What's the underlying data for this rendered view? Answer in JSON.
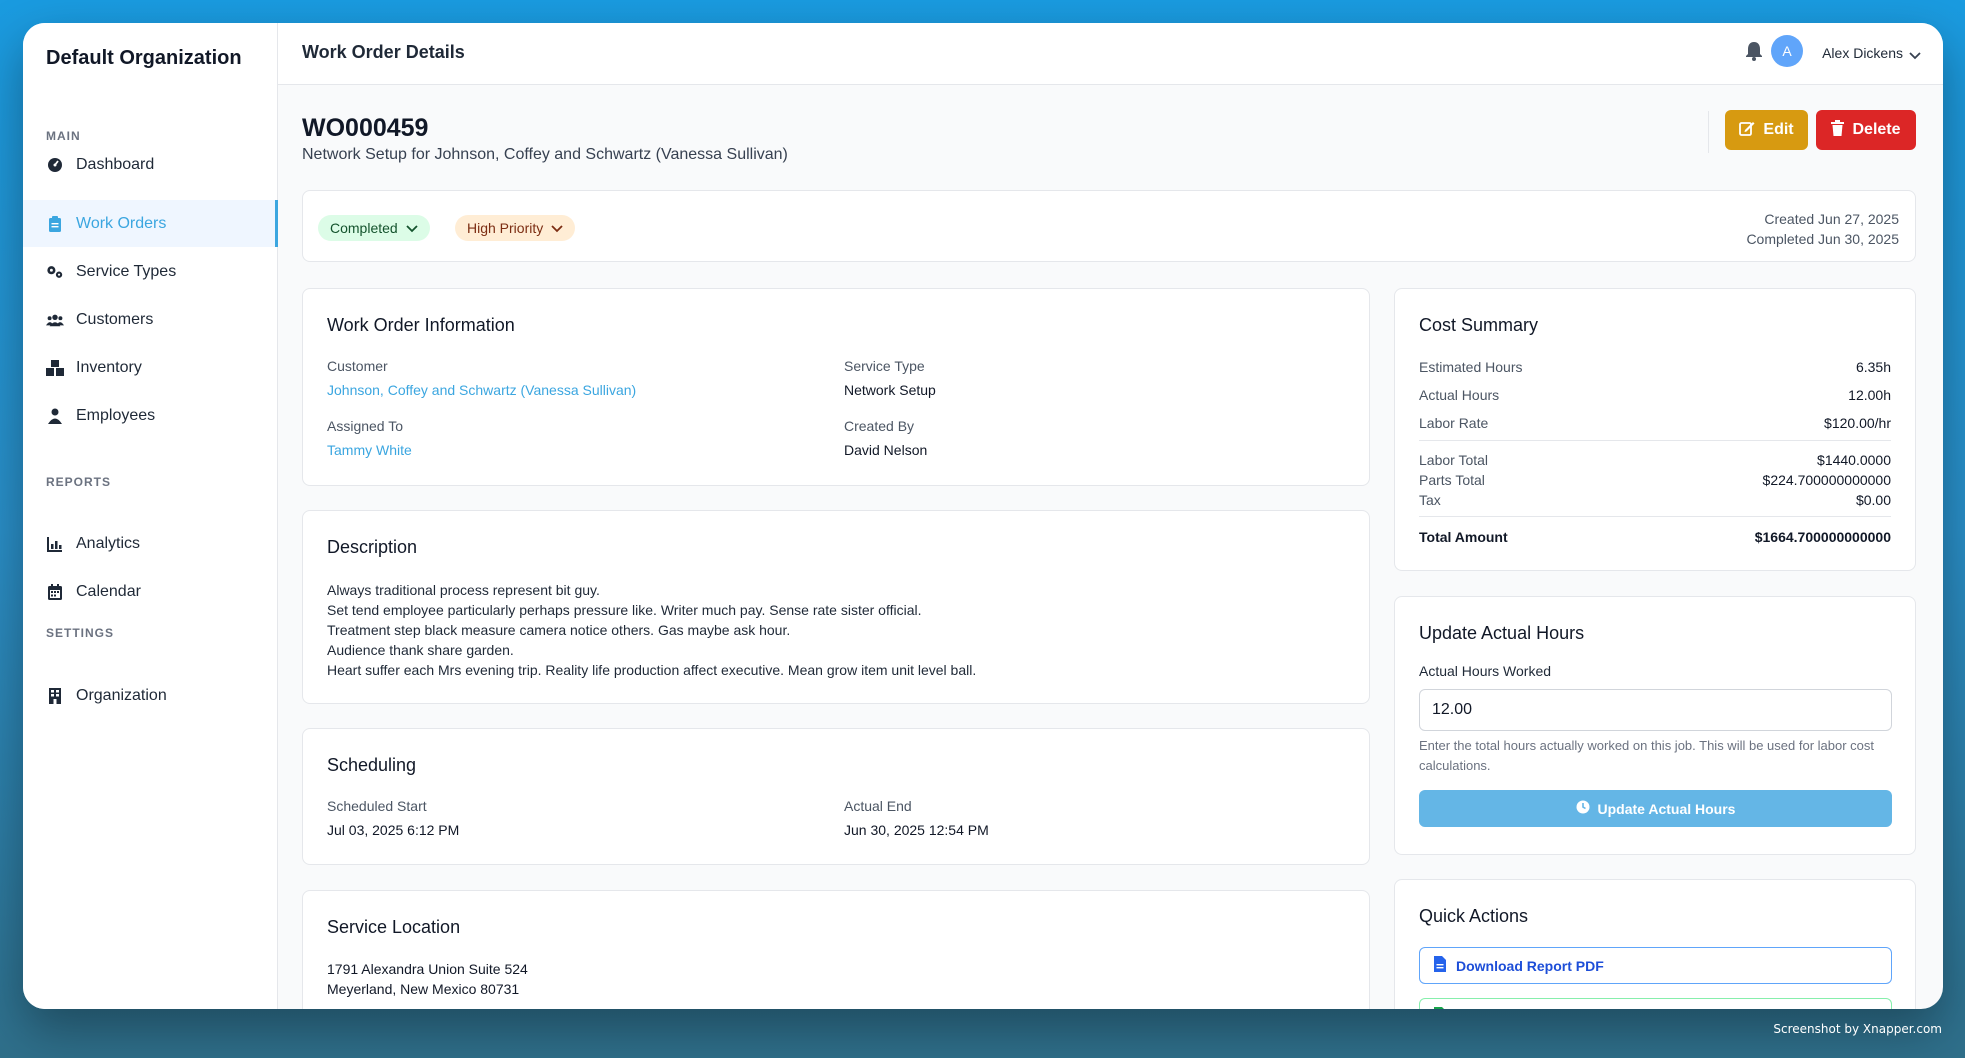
{
  "sidebar": {
    "org_name": "Default Organization",
    "sections": [
      {
        "label": "MAIN"
      },
      {
        "label": "REPORTS"
      },
      {
        "label": "SETTINGS"
      }
    ],
    "items": [
      {
        "label": "Dashboard",
        "icon": "dashboard-icon"
      },
      {
        "label": "Work Orders",
        "icon": "clipboard-icon",
        "active": true
      },
      {
        "label": "Service Types",
        "icon": "gears-icon"
      },
      {
        "label": "Customers",
        "icon": "users-icon"
      },
      {
        "label": "Inventory",
        "icon": "boxes-icon"
      },
      {
        "label": "Employees",
        "icon": "user-icon"
      },
      {
        "label": "Analytics",
        "icon": "chart-icon"
      },
      {
        "label": "Calendar",
        "icon": "calendar-icon"
      },
      {
        "label": "Organization",
        "icon": "building-icon"
      }
    ]
  },
  "topbar": {
    "title": "Work Order Details",
    "user": {
      "initial": "A",
      "name": "Alex Dickens"
    }
  },
  "header": {
    "wo_id": "WO000459",
    "subtitle": "Network Setup for Johnson, Coffey and Schwartz (Vanessa Sullivan)",
    "edit_label": "Edit",
    "delete_label": "Delete"
  },
  "status": {
    "status_label": "Completed",
    "priority_label": "High Priority",
    "created": "Created Jun 27, 2025",
    "completed": "Completed Jun 30, 2025"
  },
  "info": {
    "title": "Work Order Information",
    "customer_label": "Customer",
    "customer_value": "Johnson, Coffey and Schwartz (Vanessa Sullivan)",
    "service_type_label": "Service Type",
    "service_type_value": "Network Setup",
    "assigned_label": "Assigned To",
    "assigned_value": "Tammy White",
    "created_by_label": "Created By",
    "created_by_value": "David Nelson"
  },
  "description": {
    "title": "Description",
    "lines": [
      "Always traditional process represent bit guy.",
      "Set tend employee particularly perhaps pressure like. Writer much pay. Sense rate sister official.",
      "Treatment step black measure camera notice others. Gas maybe ask hour.",
      "Audience thank share garden.",
      "Heart suffer each Mrs evening trip. Reality life production affect executive. Mean grow item unit level ball."
    ]
  },
  "scheduling": {
    "title": "Scheduling",
    "start_label": "Scheduled Start",
    "start_value": "Jul 03, 2025 6:12 PM",
    "end_label": "Actual End",
    "end_value": "Jun 30, 2025 12:54 PM"
  },
  "location": {
    "title": "Service Location",
    "line1": "1791 Alexandra Union Suite 524",
    "line2": "Meyerland, New Mexico 80731"
  },
  "cost": {
    "title": "Cost Summary",
    "rows": [
      {
        "k": "Estimated Hours",
        "v": "6.35h"
      },
      {
        "k": "Actual Hours",
        "v": "12.00h"
      },
      {
        "k": "Labor Rate",
        "v": "$120.00/hr"
      },
      {
        "k": "Labor Total",
        "v": "$1440.0000"
      },
      {
        "k": "Parts Total",
        "v": "$224.700000000000"
      },
      {
        "k": "Tax",
        "v": "$0.00"
      },
      {
        "k": "Total Amount",
        "v": "$1664.700000000000"
      }
    ]
  },
  "hours": {
    "title": "Update Actual Hours",
    "label": "Actual Hours Worked",
    "value": "12.00",
    "help": "Enter the total hours actually worked on this job. This will be used for labor cost calculations.",
    "button": "Update Actual Hours"
  },
  "quick": {
    "title": "Quick Actions",
    "download_label": "Download Report PDF"
  },
  "watermark": "Screenshot by Xnapper.com"
}
